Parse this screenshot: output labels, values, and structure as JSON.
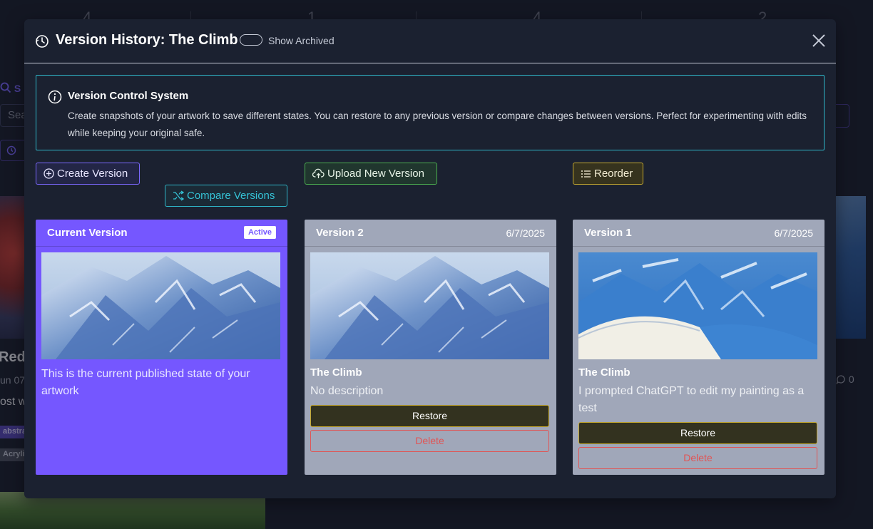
{
  "background": {
    "stats": [
      "4",
      "1",
      "4",
      "2"
    ],
    "search_label": "S",
    "search_placeholder": "Sea",
    "artwork_title": "Red",
    "artwork_date": "un 07",
    "artwork_desc": "ost w",
    "tags": [
      "abstra",
      "Acryli"
    ],
    "comments": "0"
  },
  "modal": {
    "title": "Version History: The Climb",
    "show_archived_label": "Show Archived",
    "info": {
      "title": "Version Control System",
      "text": "Create snapshots of your artwork to save different states. You can restore to any previous version or compare changes between versions. Perfect for experimenting with edits while keeping your original safe."
    },
    "buttons": {
      "create": "Create Version",
      "compare": "Compare Versions",
      "upload": "Upload New Version",
      "reorder": "Reorder"
    },
    "cards": {
      "current": {
        "name": "Current Version",
        "badge": "Active",
        "description": "This is the current published state of your artwork"
      },
      "v2": {
        "name": "Version 2",
        "date": "6/7/2025",
        "title": "The Climb",
        "description": "No description",
        "restore": "Restore",
        "delete": "Delete"
      },
      "v1": {
        "name": "Version 1",
        "date": "6/7/2025",
        "title": "The Climb",
        "description": "I prompted ChatGPT to edit my painting as a test",
        "restore": "Restore",
        "delete": "Delete"
      }
    },
    "colors": {
      "accent_purple": "#7557ff",
      "info_cyan": "#2fb6c8",
      "success_green": "#4caf50",
      "warning_gold": "#c4a830",
      "danger_red": "#e05555"
    }
  }
}
